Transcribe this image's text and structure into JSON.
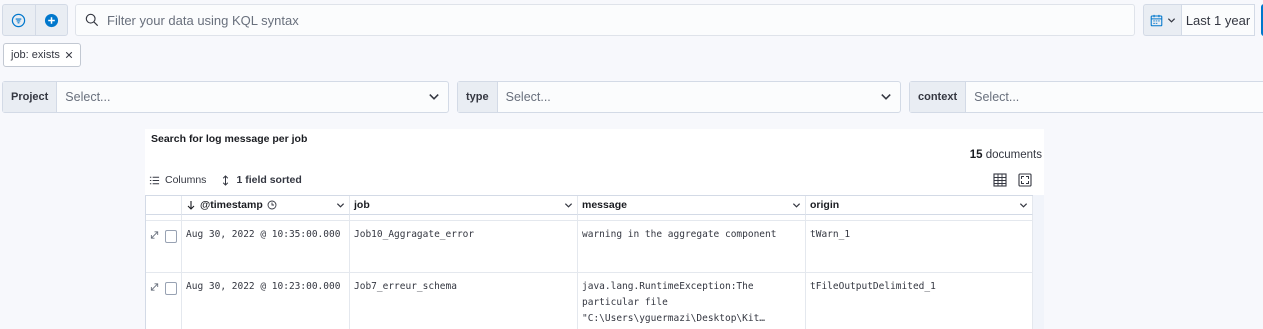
{
  "query_bar": {
    "filter_menu_icon": "filter-icon",
    "add_filter_icon": "plus-circle-icon",
    "search_placeholder": "Filter your data using KQL syntax",
    "date_range": "Last 1 year"
  },
  "filter_pills": [
    {
      "label": "job: exists"
    }
  ],
  "controls": [
    {
      "label": "Project",
      "placeholder": "Select..."
    },
    {
      "label": "type",
      "placeholder": "Select..."
    },
    {
      "label": "context",
      "placeholder": "Select..."
    }
  ],
  "panel": {
    "title": "Search for log message per job",
    "doc_count": "15",
    "doc_count_label": "documents",
    "toolbar": {
      "columns_label": "Columns",
      "sorted_label": "1 field sorted"
    },
    "columns": [
      "@timestamp",
      "job",
      "message",
      "origin"
    ],
    "rows": [
      {
        "timestamp": "Aug 30, 2022 @ 10:35:00.000",
        "job": "Job10_Aggragate_error",
        "message": "warning in the aggregate component",
        "origin": "tWarn_1"
      },
      {
        "timestamp": "Aug 30, 2022 @ 10:23:00.000",
        "job": "Job7_erreur_schema",
        "message": "java.lang.RuntimeException:The particular file \"C:\\Users\\yguermazi\\Desktop\\Kit…",
        "origin": "tFileOutputDelimited_1"
      }
    ]
  },
  "colors": {
    "accent": "#0077cc",
    "panel_bg": "#ffffff",
    "page_bg": "#f7f8fc"
  }
}
